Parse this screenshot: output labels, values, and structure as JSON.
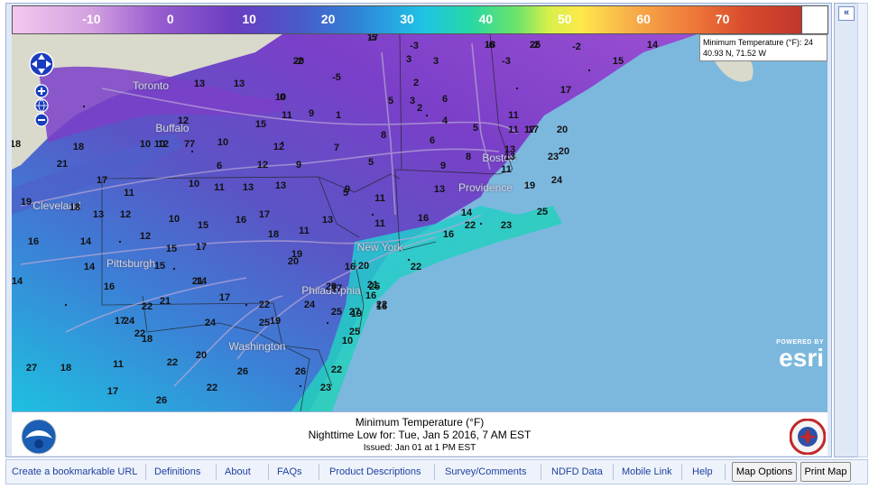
{
  "legend": {
    "labels": [
      "-10",
      "0",
      "10",
      "20",
      "30",
      "40",
      "50",
      "60",
      "70"
    ]
  },
  "popup": {
    "line1": "Minimum Temperature (°F): 24",
    "line2": "40.93 N, 71.52 W"
  },
  "cities": [
    "Toronto",
    "Buffalo",
    "Cleveland",
    "Pittsburgh",
    "New York",
    "Philadelphia",
    "Washington",
    "Boston",
    "Providence"
  ],
  "temperatures": [
    "-5",
    "-2",
    "-6",
    "-2",
    "-3",
    "-5",
    "-3",
    "-2",
    "0",
    "3",
    "2",
    "3",
    "2",
    "6",
    "14",
    "15",
    "17",
    "10",
    "13",
    "13",
    "11",
    "9",
    "1",
    "5",
    "3",
    "4",
    "5",
    "11",
    "12",
    "7",
    "15",
    "18",
    "10",
    "12",
    "7",
    "11",
    "17",
    "20",
    "20",
    "10",
    "12",
    "10",
    "7",
    "8",
    "6",
    "9",
    "13",
    "11",
    "18",
    "14",
    "6",
    "12",
    "9",
    "5",
    "5",
    "8",
    "13",
    "17",
    "23",
    "21",
    "17",
    "11",
    "10",
    "11",
    "13",
    "13",
    "9",
    "11",
    "13",
    "19",
    "24",
    "19",
    "18",
    "13",
    "12",
    "10",
    "15",
    "16",
    "17",
    "11",
    "13",
    "11",
    "16",
    "22",
    "23",
    "25",
    "16",
    "14",
    "12",
    "14",
    "15",
    "17",
    "18",
    "19",
    "20",
    "16",
    "16",
    "15",
    "14",
    "16",
    "20",
    "21",
    "21",
    "22",
    "25",
    "17",
    "16",
    "17",
    "24",
    "22",
    "27",
    "20",
    "16",
    "14",
    "17",
    "21",
    "24",
    "22",
    "25",
    "24",
    "19",
    "10",
    "18",
    "19",
    "25",
    "22",
    "25",
    "27",
    "18",
    "22",
    "20",
    "26",
    "26",
    "22",
    "11",
    "17",
    "22",
    "26",
    "22",
    "23",
    "17",
    "20",
    "18",
    "25"
  ],
  "branding": {
    "powered_by": "POWERED BY",
    "esri": "esri"
  },
  "caption": {
    "title": "Minimum Temperature (°F)",
    "subtitle": "Nighttime Low for: Tue, Jan  5 2016,   7 AM EST",
    "issued": "Issued: Jan 01 at 1 PM EST"
  },
  "side": {
    "collapse_label": "«"
  },
  "footer": {
    "links": [
      "Create a bookmarkable URL",
      "Definitions",
      "About",
      "FAQs",
      "Product Descriptions",
      "Survey/Comments",
      "NDFD Data",
      "Mobile Link",
      "Help"
    ],
    "buttons": [
      "Map Options",
      "Print Map"
    ]
  },
  "colors": {
    "ocean": "#7cb8de",
    "land_warm": "#2ad6c8",
    "land_cold": "#7b3fc8",
    "canada": "#d9d9cc"
  }
}
